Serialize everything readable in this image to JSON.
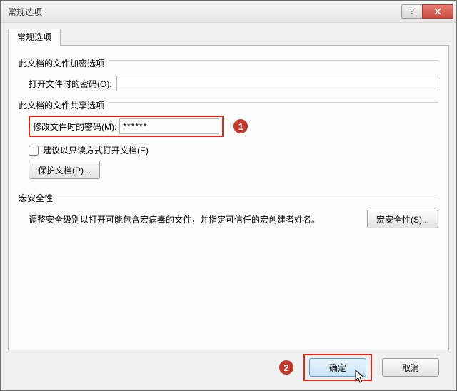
{
  "window": {
    "title": "常规选项"
  },
  "tabs": {
    "general": "常规选项"
  },
  "encrypt_group": {
    "title": "此文档的文件加密选项",
    "open_password_label": "打开文件时的密码(O):",
    "open_password_value": ""
  },
  "share_group": {
    "title": "此文档的文件共享选项",
    "modify_password_label": "修改文件时的密码(M):",
    "modify_password_value": "******",
    "readonly_checkbox_label": "建议以只读方式打开文档(E)",
    "readonly_checked": false,
    "protect_button": "保护文档(P)..."
  },
  "macro_group": {
    "title": "宏安全性",
    "description": "调整安全级别以打开可能包含宏病毒的文件，并指定可信任的宏创建者姓名。",
    "button": "宏安全性(S)..."
  },
  "footer": {
    "ok": "确定",
    "cancel": "取消"
  },
  "callouts": {
    "one": "1",
    "two": "2"
  }
}
